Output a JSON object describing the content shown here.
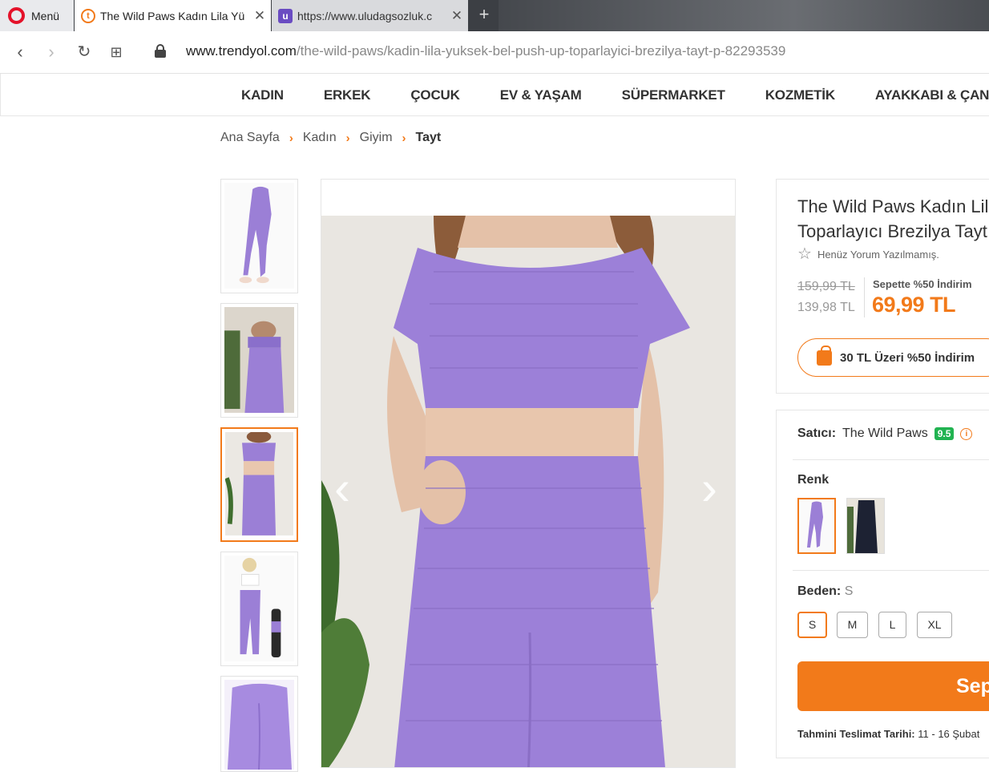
{
  "browser": {
    "menu_label": "Menü",
    "tabs": [
      {
        "title": "The Wild Paws Kadın Lila Yü",
        "favicon": "trendyol-icon"
      },
      {
        "title": "https://www.uludagsozluk.c",
        "favicon": "uludagsozluk-icon"
      }
    ],
    "url_host": "www.trendyol.com",
    "url_path": "/the-wild-paws/kadin-lila-yuksek-bel-push-up-toparlayici-brezilya-tayt-p-82293539"
  },
  "site_nav": [
    "KADIN",
    "ERKEK",
    "ÇOCUK",
    "EV & YAŞAM",
    "SÜPERMARKET",
    "KOZMETİK",
    "AYAKKABI & ÇANTA"
  ],
  "breadcrumb": [
    "Ana Sayfa",
    "Kadın",
    "Giyim",
    "Tayt"
  ],
  "product": {
    "title_line1": "The Wild Paws Kadın Lila Yüksek",
    "title_line2": "Toparlayıcı Brezilya Tayt",
    "rating_text": "Henüz Yorum Yazılmamış.",
    "old_price": "159,99 TL",
    "prev_price": "139,98 TL",
    "discount_label": "Sepette %50 İndirim",
    "final_price": "69,99 TL",
    "promo_text": "30 TL Üzeri %50 İndirim",
    "seller_label": "Satıcı:",
    "seller_name": "The Wild Paws",
    "seller_score": "9.5",
    "color_label": "Renk",
    "size_label": "Beden:",
    "size_selected": "S",
    "sizes": [
      "S",
      "M",
      "L",
      "XL"
    ],
    "cart_button": "Sepete Ekle",
    "delivery_label": "Tahmini Teslimat Tarihi:",
    "delivery_value": "11 - 16 Şubat"
  },
  "colors": {
    "accent": "#f27a1a",
    "lilac": "#9b7fd6",
    "seller_score_bg": "#21b351"
  }
}
